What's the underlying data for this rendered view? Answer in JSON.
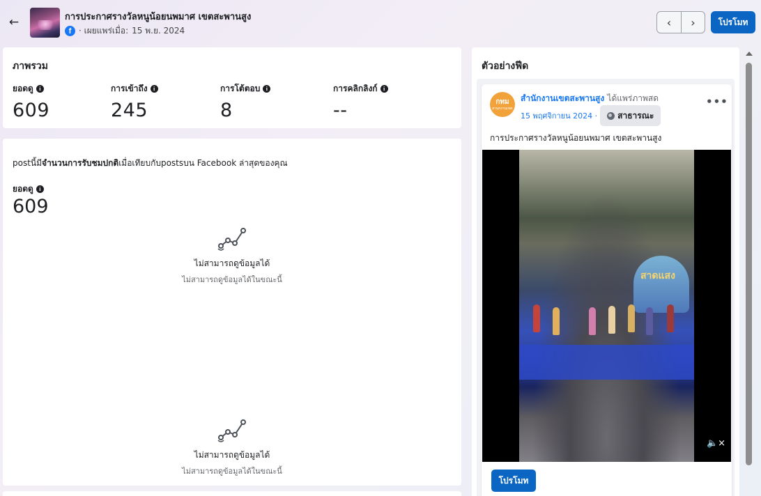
{
  "header": {
    "title": "การประกาศรางวัลหนูน้อยนพมาศ เขตสะพานสูง",
    "published_prefix": "· เผยแพร่เมื่อ:",
    "published_date": "15 พ.ย. 2024",
    "promote_label": "โปรโมท",
    "icons": {
      "back": "arrow-left-icon",
      "platform": "facebook-icon",
      "prev": "chevron-left-icon",
      "next": "chevron-right-icon"
    }
  },
  "overview": {
    "title": "ภาพรวม",
    "metrics": [
      {
        "label": "ยอดดู",
        "value": "609"
      },
      {
        "label": "การเข้าถึง",
        "value": "245"
      },
      {
        "label": "การโต้ตอบ",
        "value": "8"
      },
      {
        "label": "การคลิกลิงก์",
        "value": "--"
      }
    ]
  },
  "detail": {
    "compare_prefix": "postนี้มี",
    "compare_bold": "จำนวนการรับชมปกติ",
    "compare_suffix": "เมื่อเทียบกับpostsบน Facebook ล่าสุดของคุณ",
    "views_label": "ยอดดู",
    "views_value": "609",
    "nodata": [
      {
        "title": "ไม่สามารถดูข้อมูลได้",
        "subtitle": "ไม่สามารถดูข้อมูลได้ในขณะนี้"
      },
      {
        "title": "ไม่สามารถดูข้อมูลได้",
        "subtitle": "ไม่สามารถดูข้อมูลได้ในขณะนี้"
      }
    ]
  },
  "preview": {
    "title": "ตัวอย่างฟีด",
    "page_name": "สำนักงานเขตสะพานสูง",
    "shared_text": "ได้แพร่ภาพสด",
    "avatar_text": "กทม",
    "avatar_subtext": "สำนักงานเขตสะพานสูง",
    "post_date": "15 พฤศจิกายน 2024 ·",
    "privacy_label": "สาธารณะ",
    "caption": "การประกาศรางวัลหนูน้อยนพมาศ เขตสะพานสูง",
    "video_sign_text": "สาดแสง",
    "promote_label": "โปรโมท",
    "icons": {
      "more": "more-options-icon",
      "mute": "volume-muted-icon",
      "privacy": "globe-icon"
    }
  },
  "colors": {
    "accent": "#0a66c2",
    "link": "#1877f2",
    "text": "#1c1e21",
    "muted": "#65676b"
  }
}
